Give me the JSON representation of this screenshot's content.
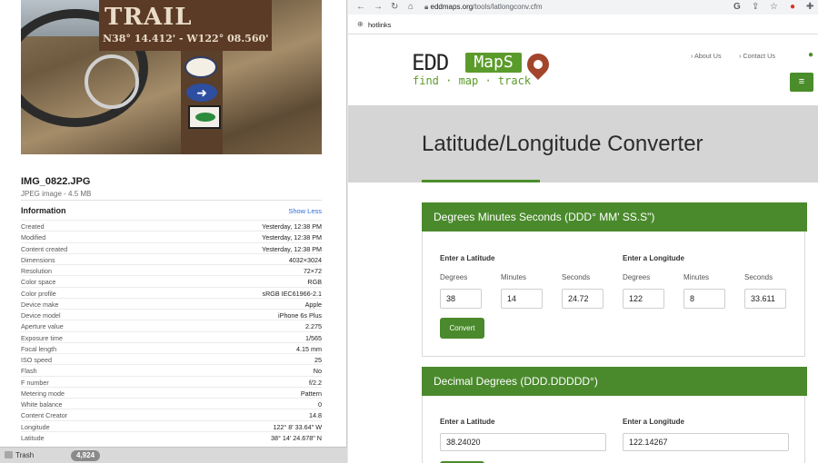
{
  "finder": {
    "file_name": "IMG_0822.JPG",
    "file_meta": "JPEG image - 4.5 MB",
    "photo": {
      "sign_text": "TRAIL",
      "coords_text": "N38° 14.412' - W122° 08.560'"
    },
    "info_title": "Information",
    "show_less": "Show Less",
    "rows": [
      {
        "k": "Created",
        "v": "Yesterday, 12:38 PM"
      },
      {
        "k": "Modified",
        "v": "Yesterday, 12:38 PM"
      },
      {
        "k": "Content created",
        "v": "Yesterday, 12:38 PM"
      },
      {
        "k": "Dimensions",
        "v": "4032×3024"
      },
      {
        "k": "Resolution",
        "v": "72×72"
      },
      {
        "k": "Color space",
        "v": "RGB"
      },
      {
        "k": "Color profile",
        "v": "sRGB IEC61966-2.1"
      },
      {
        "k": "Device make",
        "v": "Apple"
      },
      {
        "k": "Device model",
        "v": "iPhone 6s Plus"
      },
      {
        "k": "Aperture value",
        "v": "2.275"
      },
      {
        "k": "Exposure time",
        "v": "1/565"
      },
      {
        "k": "Focal length",
        "v": "4.15 mm"
      },
      {
        "k": "ISO speed",
        "v": "25"
      },
      {
        "k": "Flash",
        "v": "No"
      },
      {
        "k": "F number",
        "v": "f/2.2"
      },
      {
        "k": "Metering mode",
        "v": "Pattern"
      },
      {
        "k": "White balance",
        "v": "0"
      },
      {
        "k": "Content Creator",
        "v": "14.8"
      },
      {
        "k": "Longitude",
        "v": "122° 8' 33.64\" W"
      },
      {
        "k": "Latitude",
        "v": "38° 14' 24.678\" N"
      }
    ],
    "trash_label": "Trash",
    "trash_count": "4,924"
  },
  "browser": {
    "url_host": "eddmaps.org",
    "url_path": "/tools/latlongconv.cfm",
    "bookmark": "hotlinks"
  },
  "site": {
    "logo_edd": "EDD",
    "logo_maps": "MapS",
    "logo_tagline": "find · map · track",
    "nav_about": "› About Us",
    "nav_contact": "› Contact Us",
    "menu_icon": "≡",
    "page_title": "Latitude/Longitude Converter"
  },
  "dms": {
    "header": "Degrees Minutes Seconds (DDD° MM' SS.S\")",
    "lat_heading": "Enter a Latitude",
    "lon_heading": "Enter a Longitude",
    "col_degrees": "Degrees",
    "col_minutes": "Minutes",
    "col_seconds": "Seconds",
    "lat_deg": "38",
    "lat_min": "14",
    "lat_sec": "24.72",
    "lon_deg": "122",
    "lon_min": "8",
    "lon_sec": "33.611",
    "convert_label": "Convert"
  },
  "dd": {
    "header": "Decimal Degrees (DDD.DDDDD°)",
    "lat_heading": "Enter a Latitude",
    "lon_heading": "Enter a Longitude",
    "lat_value": "38.24020",
    "lon_value": "122.14267"
  }
}
